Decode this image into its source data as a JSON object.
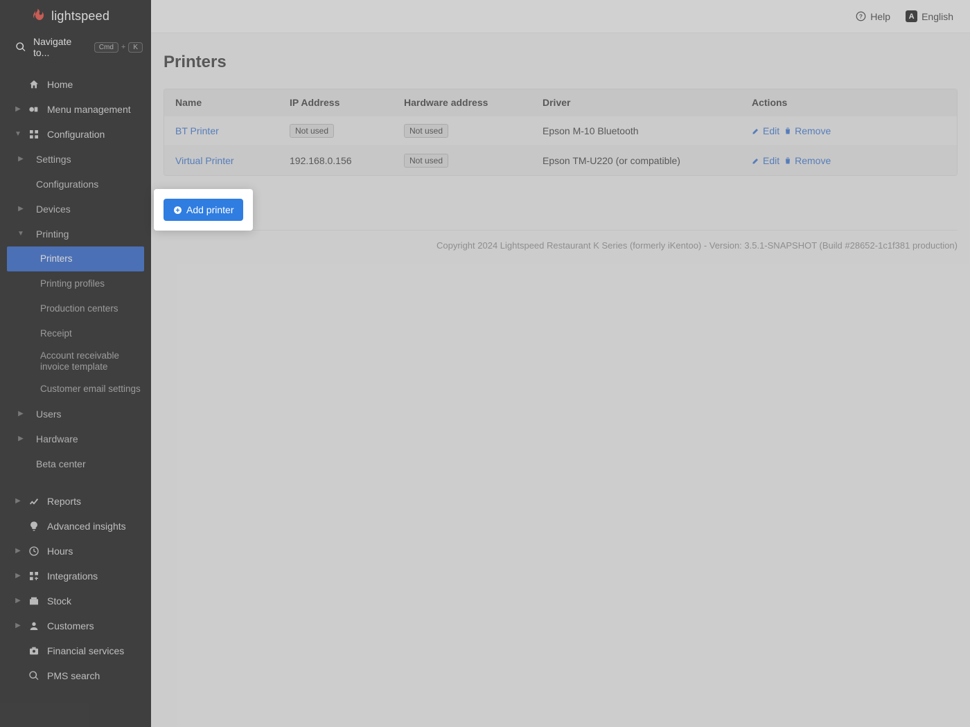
{
  "brand": "lightspeed",
  "search": {
    "placeholder": "Navigate to...",
    "kbd1": "Cmd",
    "kbd2": "K"
  },
  "topbar": {
    "help": "Help",
    "language": "English",
    "lang_badge": "A"
  },
  "sidebar": {
    "home": "Home",
    "menu_mgmt": "Menu management",
    "configuration": "Configuration",
    "settings": "Settings",
    "configurations": "Configurations",
    "devices": "Devices",
    "printing": "Printing",
    "printers": "Printers",
    "printing_profiles": "Printing profiles",
    "production_centers": "Production centers",
    "receipt": "Receipt",
    "ar_invoice": "Account receivable invoice template",
    "cust_email": "Customer email settings",
    "users": "Users",
    "hardware": "Hardware",
    "beta": "Beta center",
    "reports": "Reports",
    "insights": "Advanced insights",
    "hours": "Hours",
    "integrations": "Integrations",
    "stock": "Stock",
    "customers": "Customers",
    "fin_services": "Financial services",
    "pms": "PMS search"
  },
  "page": {
    "title": "Printers"
  },
  "table": {
    "headers": {
      "name": "Name",
      "ip": "IP Address",
      "hw": "Hardware address",
      "driver": "Driver",
      "actions": "Actions"
    },
    "not_used": "Not used",
    "edit": "Edit",
    "remove": "Remove",
    "rows": [
      {
        "name": "BT Printer",
        "ip_badge": true,
        "ip": "",
        "hw_badge": true,
        "hw": "",
        "driver": "Epson M-10 Bluetooth"
      },
      {
        "name": "Virtual Printer",
        "ip_badge": false,
        "ip": "192.168.0.156",
        "hw_badge": true,
        "hw": "",
        "driver": "Epson TM-U220 (or compatible)"
      }
    ]
  },
  "add_printer": "Add printer",
  "footer": "Copyright 2024 Lightspeed Restaurant K Series (formerly iKentoo) - Version: 3.5.1-SNAPSHOT (Build #28652-1c1f381 production)"
}
